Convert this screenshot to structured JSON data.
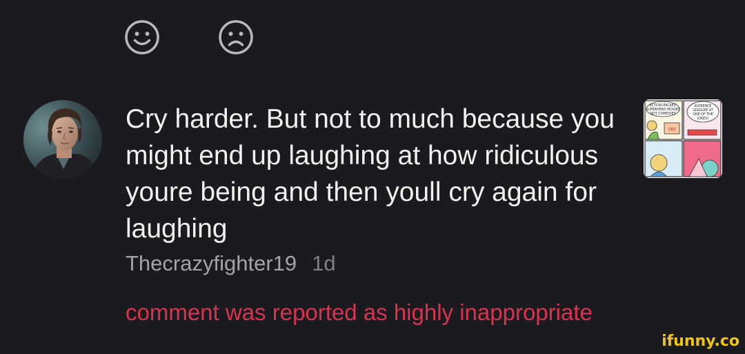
{
  "reactions": {
    "happy_icon": "smile-face-icon",
    "sad_icon": "frown-face-icon"
  },
  "comment": {
    "text": "Cry harder. But not to much because you might end up laughing at how ridiculous youre being and then youll cry again for laughing",
    "username": "Thecrazyfighter19",
    "age": "1d",
    "moderation_notice": "comment was reported as highly inappropriate"
  },
  "thumbnail": {
    "caption_left": "ACTION-PACKED SUPERHERO MOVIES NOT COMEDIES GOD DAMMIT",
    "caption_right": "SHIT AUDIENCE GIGGLED AT ONE OF THE JOKES!",
    "label_small": "CEO"
  },
  "watermark": "ifunny.co",
  "colors": {
    "background": "#1b1b1f",
    "text": "#f2f2f2",
    "meta": "#a4a4a8",
    "alert": "#d8334f",
    "watermark": "#f0c417"
  }
}
